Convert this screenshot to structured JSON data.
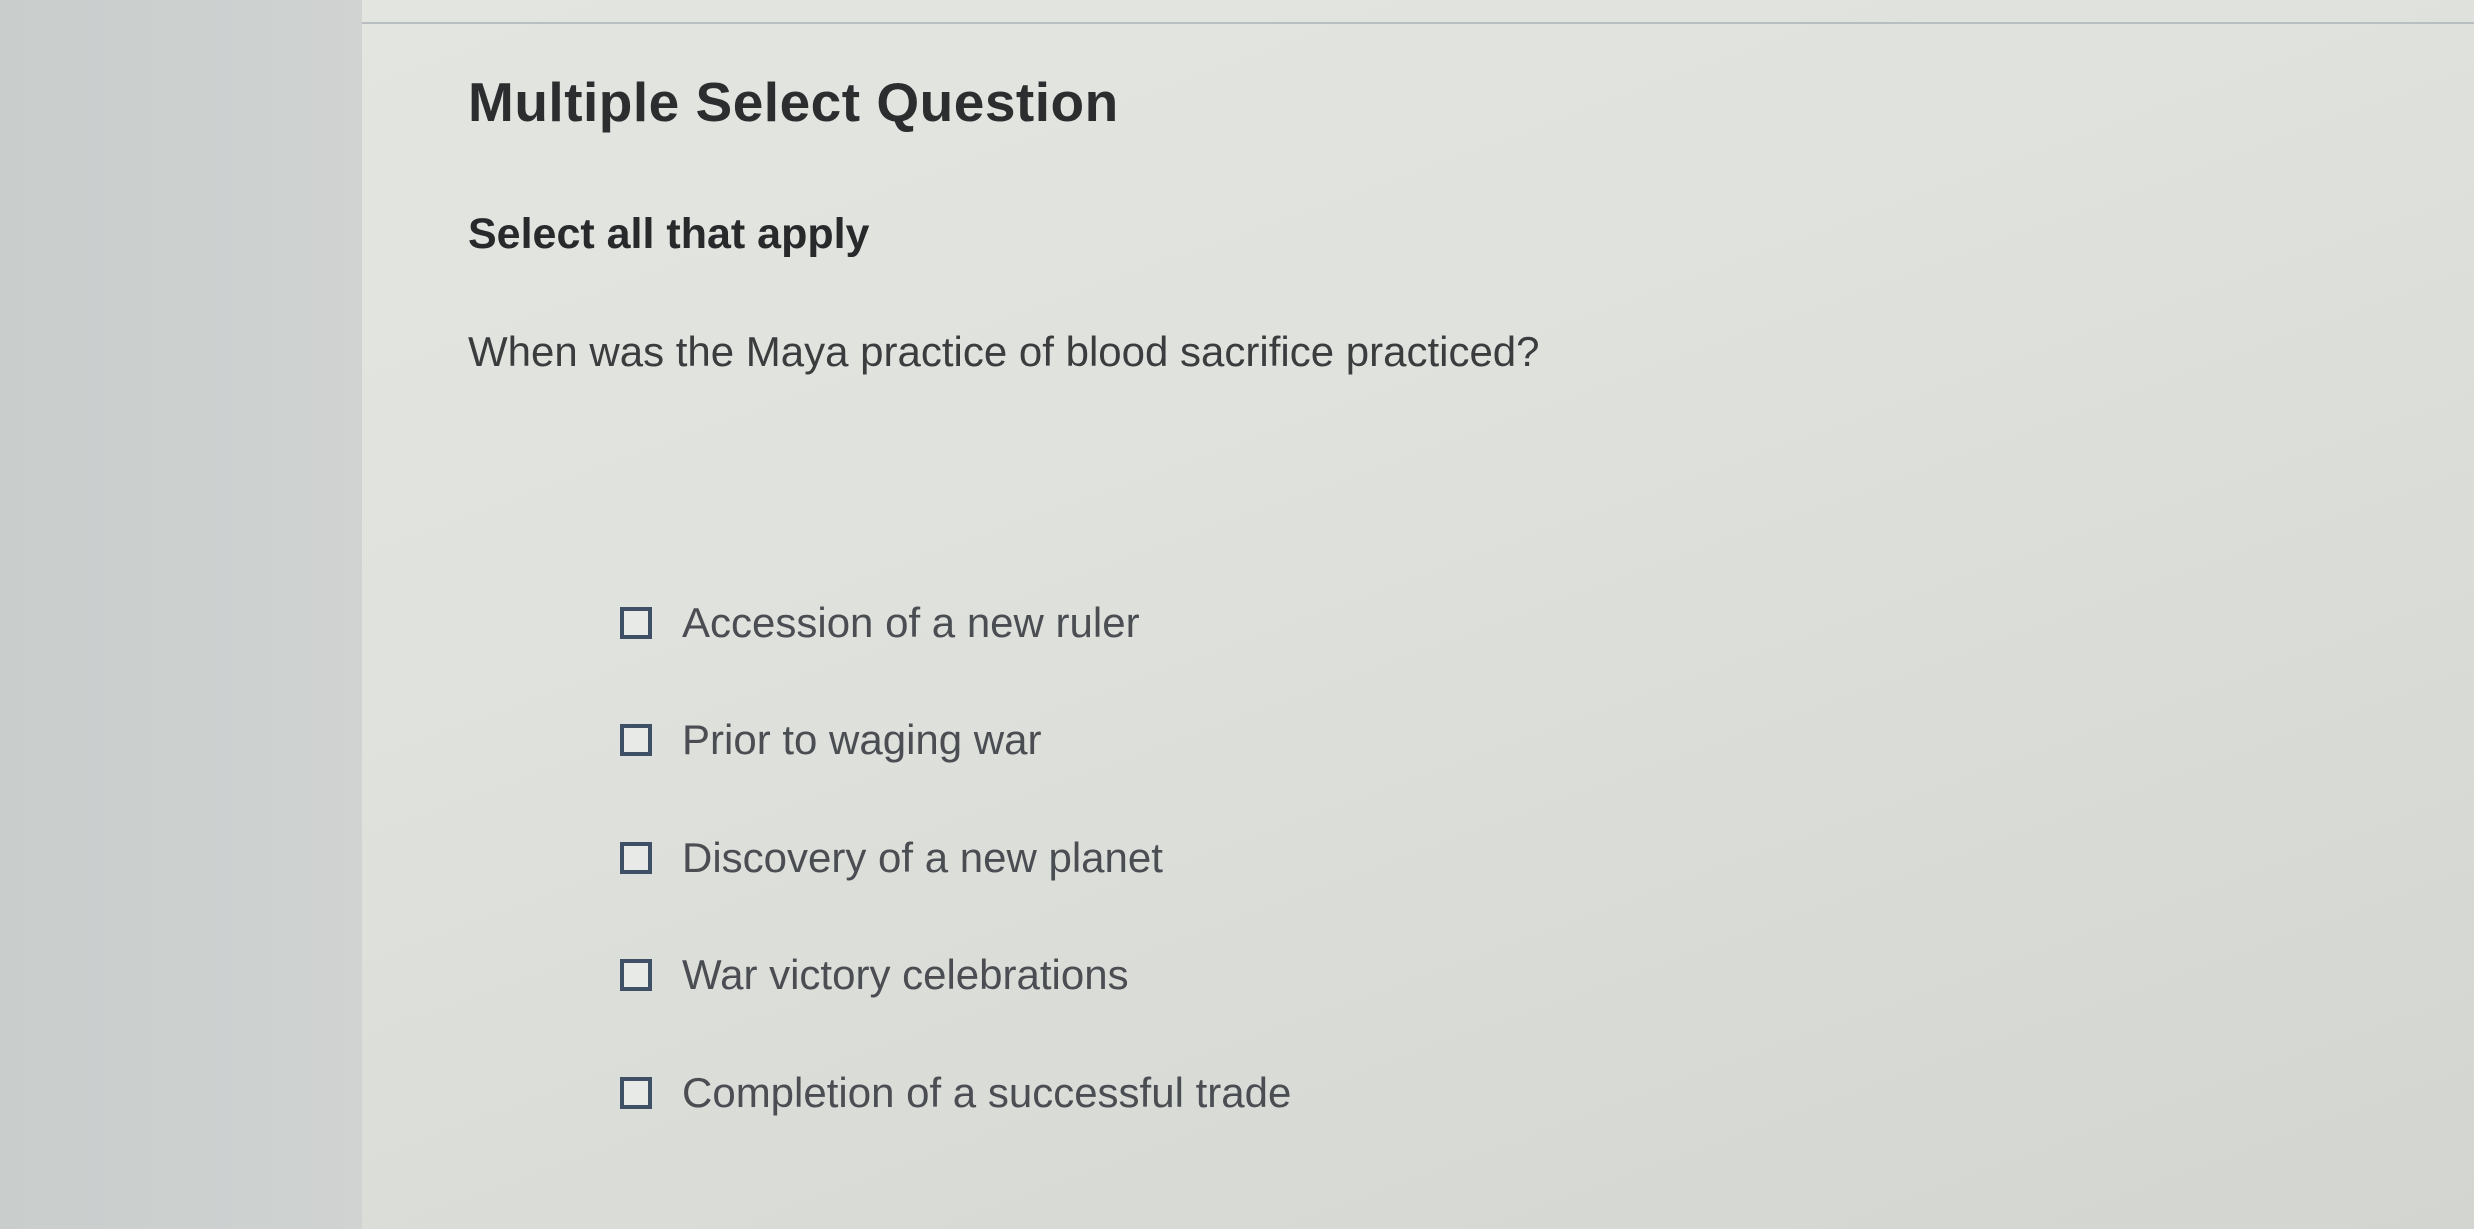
{
  "question_panel": {
    "title": "Multiple Select Question",
    "instruction": "Select all that apply",
    "prompt": "When was the Maya practice of blood sacrifice practiced?",
    "options": [
      {
        "label": "Accession of a new ruler",
        "checked": false
      },
      {
        "label": "Prior to waging war",
        "checked": false
      },
      {
        "label": "Discovery of a new planet",
        "checked": false
      },
      {
        "label": "War victory celebrations",
        "checked": false
      },
      {
        "label": "Completion of a successful trade",
        "checked": false
      }
    ]
  },
  "colors": {
    "checkbox_border": "#3f4f66",
    "title_text": "#2b2d2f",
    "option_text": "#4a4d52"
  }
}
